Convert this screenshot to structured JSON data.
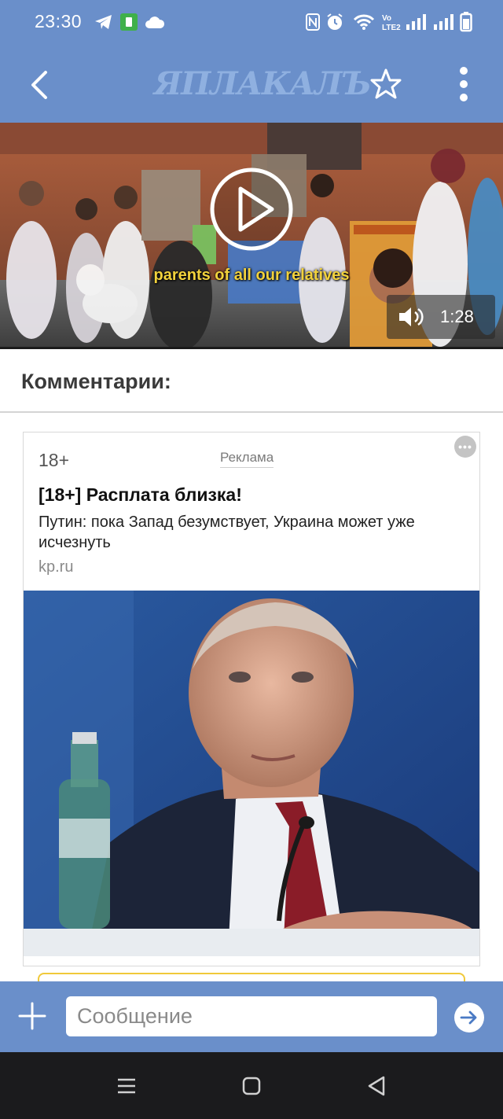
{
  "status_bar": {
    "time": "23:30",
    "icons": [
      "telegram-icon",
      "app-notification-icon",
      "cloud-icon",
      "nfc-icon",
      "alarm-icon",
      "wifi-icon",
      "volte-icon",
      "signal-icon",
      "signal-icon-2",
      "battery-icon"
    ]
  },
  "header": {
    "logo_text": "ЯПЛАКАЛЪ",
    "back_icon": "back-arrow-icon",
    "favorite_icon": "star-icon",
    "menu_icon": "more-vertical-icon"
  },
  "video": {
    "subtitle": "parents of all our relatives",
    "duration": "1:28",
    "play_icon": "play-icon",
    "volume_icon": "volume-icon"
  },
  "comments": {
    "title": "Комментарии:"
  },
  "ad": {
    "age_rating": "18+",
    "label": "Реклама",
    "title": "[18+] Расплата близка!",
    "text": "Путин: пока Запад безумствует, Украина может уже исчезнуть",
    "domain": "kp.ru",
    "more_icon": "more-horizontal-icon"
  },
  "message_bar": {
    "placeholder": "Сообщение",
    "attach_icon": "plus-icon",
    "send_icon": "send-icon"
  },
  "nav_bar": {
    "buttons": [
      "menu-icon",
      "home-icon",
      "back-icon"
    ]
  },
  "colors": {
    "header": "#6a8fca",
    "nav": "#1b1b1d",
    "subtitle": "#f2d23c",
    "cta_border": "#f0c93a"
  }
}
